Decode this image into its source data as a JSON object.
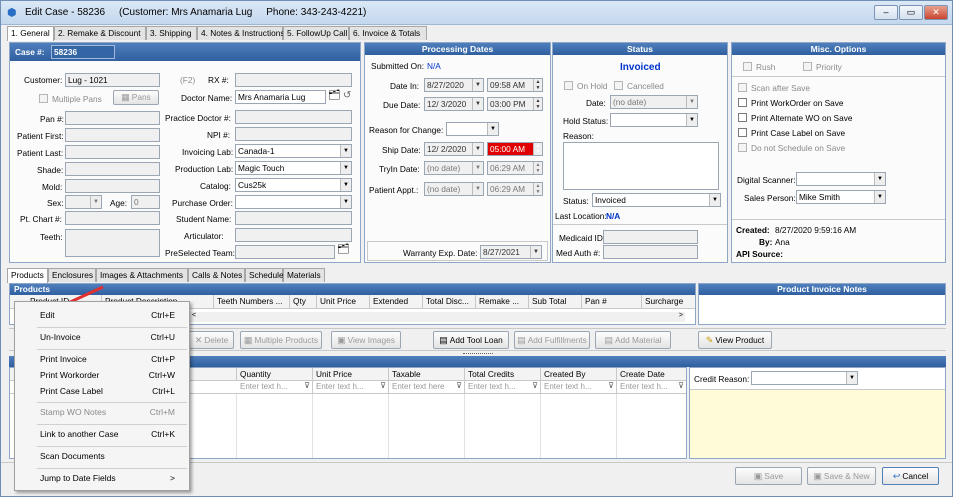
{
  "window": {
    "title": "Edit Case - 58236",
    "customer_info": "(Customer: Mrs Anamaria Lug",
    "phone_info": "Phone: 343-243-4221)"
  },
  "tabs": [
    "1. General",
    "2. Remake & Discount",
    "3. Shipping",
    "4. Notes & Instructions",
    "5. FollowUp Call",
    "6. Invoice & Totals"
  ],
  "case": {
    "header_label": "Case #:",
    "case_no": "58236",
    "labels": {
      "customer": "Customer:",
      "multiple_pans": "Multiple Pans",
      "pans_btn": "Pans",
      "pan": "Pan #:",
      "patient_first": "Patient First:",
      "patient_last": "Patient Last:",
      "shade": "Shade:",
      "mold": "Mold:",
      "sex": "Sex:",
      "age": "Age:",
      "pt_chart": "Pt. Chart #:",
      "teeth": "Teeth:"
    },
    "customer": "Lug - 1021",
    "f2": "(F2)",
    "age": "0",
    "right_labels": {
      "rx": "RX #:",
      "doctor": "Doctor Name:",
      "practice_doctor": "Practice Doctor #:",
      "npi": "NPI #:",
      "invoicing_lab": "Invoicing Lab:",
      "production_lab": "Production Lab:",
      "catalog": "Catalog:",
      "purchase_order": "Purchase Order:",
      "student": "Student Name:",
      "articulator": "Articulator:",
      "preselected": "PreSelected Team:"
    },
    "doctor": "Mrs Anamaria Lug",
    "invoicing_lab": "Canada-1",
    "production_lab": "Magic Touch",
    "catalog": "Cus25k"
  },
  "processing": {
    "title": "Processing Dates",
    "submitted_label": "Submitted On:",
    "submitted_value": "N/A",
    "date_in_label": "Date In:",
    "date_in": "8/27/2020",
    "date_in_time": "09:58 AM",
    "due_label": "Due Date:",
    "due": "12/ 3/2020",
    "due_time": "03:00 PM",
    "reason_label": "Reason for Change:",
    "ship_label": "Ship Date:",
    "ship": "12/ 2/2020",
    "ship_time": "05:00 AM",
    "tryin_label": "TryIn Date:",
    "tryin": "(no date)",
    "tryin_time": "06:29 AM",
    "appt_label": "Patient Appt.:",
    "appt": "(no date)",
    "appt_time": "06:29 AM",
    "warranty_label": "Warranty Exp. Date:",
    "warranty": "8/27/2021"
  },
  "status": {
    "title": "Status",
    "value": "Invoiced",
    "on_hold": "On Hold",
    "cancelled": "Cancelled",
    "date_label": "Date:",
    "date_value": "(no date)",
    "hold_label": "Hold Status:",
    "reason_label": "Reason:",
    "status_label": "Status:",
    "status_value": "Invoiced",
    "last_loc_label": "Last Location:",
    "last_loc_value": "N/A",
    "medicaid_label": "Medicaid ID:",
    "medauth_label": "Med Auth #:"
  },
  "misc": {
    "title": "Misc. Options",
    "rush": "Rush",
    "priority": "Priority",
    "scan_after_save": "Scan after Save",
    "print_wo": "Print WorkOrder on Save",
    "print_alt_wo": "Print Alternate WO on Save",
    "print_case_label": "Print Case Label on Save",
    "no_schedule": "Do not Schedule on Save",
    "digital_scanner_label": "Digital Scanner:",
    "sales_label": "Sales Person:",
    "sales_value": "Mike Smith",
    "created_label": "Created:",
    "created_value": "8/27/2020 9:59:16 AM",
    "by_label": "By:",
    "by_value": "Ana",
    "api_label": "API Source:"
  },
  "subtabs": [
    "Products",
    "Enclosures",
    "Images & Attachments",
    "Calls & Notes",
    "Schedule",
    "Materials"
  ],
  "products": {
    "title": "Products",
    "columns": [
      "Product ID",
      "Product Description",
      "Teeth Numbers ...",
      "Qty",
      "Unit Price",
      "Extended",
      "Total Disc...",
      "Remake ...",
      "Sub Total",
      "Pan #",
      "Surcharge"
    ],
    "notes_title": "Product Invoice Notes",
    "buttons": {
      "delete": "Delete",
      "multiple": "Multiple Products",
      "view_images": "View Images",
      "add_tool_loan": "Add Tool Loan",
      "add_fulfillments": "Add Fulfillments",
      "add_material": "Add Material",
      "view_product": "View Product"
    }
  },
  "lower": {
    "columns": [
      "Quantity",
      "Unit Price",
      "Taxable",
      "Total Credits",
      "Created By",
      "Create Date"
    ],
    "filters": [
      "Enter text h...",
      "Enter text h...",
      "Enter text here",
      "Enter text h...",
      "Enter text h...",
      "Enter text h..."
    ],
    "credit_reason_label": "Credit Reason:"
  },
  "footer": {
    "save": "Save",
    "save_new": "Save & New",
    "cancel": "Cancel"
  },
  "context_menu": [
    {
      "label": "Edit",
      "shortcut": "Ctrl+E",
      "enabled": true
    },
    {
      "label": "Un-Invoice",
      "shortcut": "Ctrl+U",
      "enabled": true
    },
    {
      "label": "Print Invoice",
      "shortcut": "Ctrl+P",
      "enabled": true
    },
    {
      "label": "Print Workorder",
      "shortcut": "Ctrl+W",
      "enabled": true
    },
    {
      "label": "Print Case Label",
      "shortcut": "Ctrl+L",
      "enabled": true
    },
    {
      "label": "Stamp WO Notes",
      "shortcut": "Ctrl+M",
      "enabled": false
    },
    {
      "label": "Link to another Case",
      "shortcut": "Ctrl+K",
      "enabled": true
    },
    {
      "label": "Scan Documents",
      "shortcut": "",
      "enabled": true
    },
    {
      "label": "Jump to Date Fields",
      "shortcut": ">",
      "enabled": true
    }
  ],
  "colors": {
    "header_blue": "#3a6aab",
    "invoiced_blue": "#0033cc",
    "ship_time_red": "#e00000",
    "notes_yellow": "#fffad8",
    "menu_arrow_red": "#e03030"
  }
}
